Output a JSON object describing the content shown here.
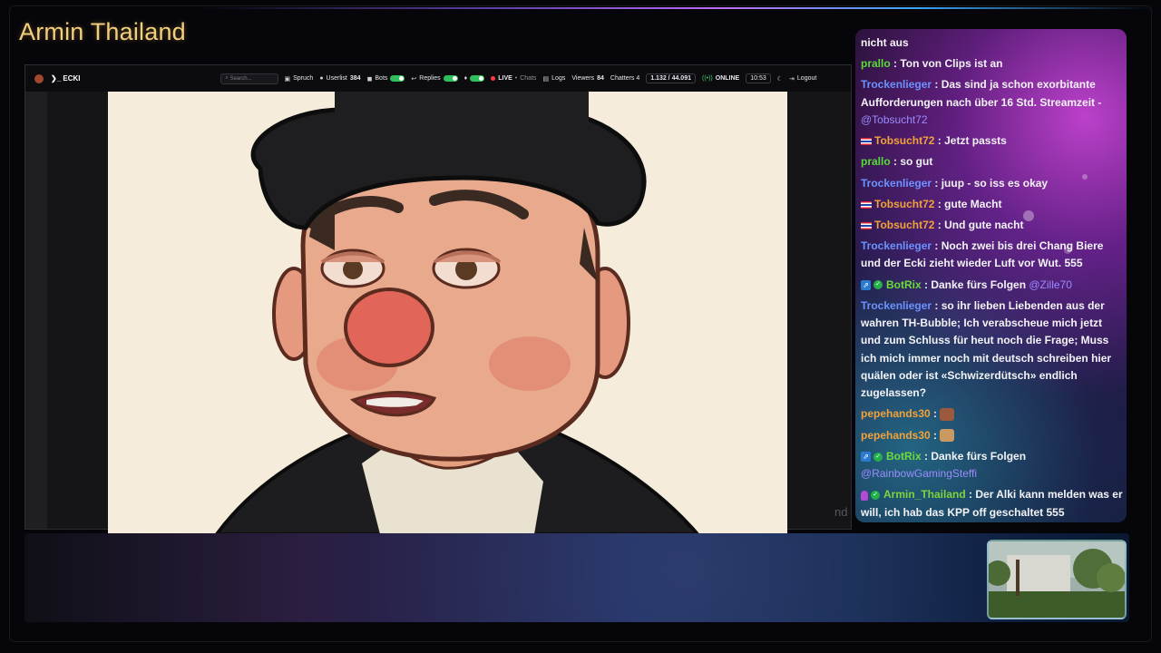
{
  "channel_title": "Armin Thailand",
  "toolbar": {
    "brand": "ECKI",
    "search_placeholder": "Search...",
    "spruch": "Spruch",
    "userlist_label": "Userlist",
    "userlist_count": "384",
    "bots": "Bots",
    "replies": "Replies",
    "live": "LIVE",
    "chats": "Chats",
    "logs": "Logs",
    "viewers_label": "Viewers",
    "viewers_count": "84",
    "chatters": "Chatters 4",
    "stats": "1.132 / 44.091",
    "online": "ONLINE",
    "time": "10:53",
    "logout": "Logout"
  },
  "video_side_text": "nd",
  "chat": [
    {
      "user": "",
      "text": "nicht aus"
    },
    {
      "user": "prallo",
      "color": "#55dd33",
      "text": "Ton von Clips ist an"
    },
    {
      "user": "Trockenlieger",
      "color": "#6b93ff",
      "text": "Das sind ja schon exorbitante Aufforderungen nach über 16 Std. Streamzeit -",
      "mention": "@Tobsucht72"
    },
    {
      "user": "Tobsucht72",
      "color": "#f2a23a",
      "badge": "flag",
      "text": "Jetzt passts"
    },
    {
      "user": "prallo",
      "color": "#55dd33",
      "text": "so gut"
    },
    {
      "user": "Trockenlieger",
      "color": "#6b93ff",
      "text": "juup - so iss es okay"
    },
    {
      "user": "Tobsucht72",
      "color": "#f2a23a",
      "badge": "flag",
      "text": "gute Macht"
    },
    {
      "user": "Tobsucht72",
      "color": "#f2a23a",
      "badge": "flag",
      "text": "Und gute nacht"
    },
    {
      "user": "Trockenlieger",
      "color": "#6b93ff",
      "text": "Noch zwei bis drei Chang Biere und der Ecki zieht wieder Luft vor Wut. 555"
    },
    {
      "user": "BotRix",
      "color": "#6bdc3a",
      "badge": "bot",
      "text": "Danke fürs Folgen",
      "mention": "@Zille70"
    },
    {
      "user": "Trockenlieger",
      "color": "#6b93ff",
      "text": "so ihr lieben Liebenden aus der wahren TH-Bubble; Ich verabscheue mich jetzt und zum Schluss für heut noch die Frage; Muss ich mich immer noch mit deutsch schreiben hier quälen oder ist «Schwizerdütsch» endlich zugelassen?"
    },
    {
      "user": "pepehands30",
      "color": "#f2a23a",
      "emote": "#9b5a3c",
      "text": ""
    },
    {
      "user": "pepehands30",
      "color": "#f2a23a",
      "emote": "#c89a61",
      "text": ""
    },
    {
      "user": "BotRix",
      "color": "#6bdc3a",
      "badge": "bot",
      "text": "Danke fürs Folgen",
      "mention": "@RainbowGamingSteffi"
    },
    {
      "user": "Armin_Thailand",
      "color": "#7fd43c",
      "badge": "mod",
      "text": "Der Alki kann melden was er will, ich hab das KPP off geschaltet 555"
    }
  ]
}
